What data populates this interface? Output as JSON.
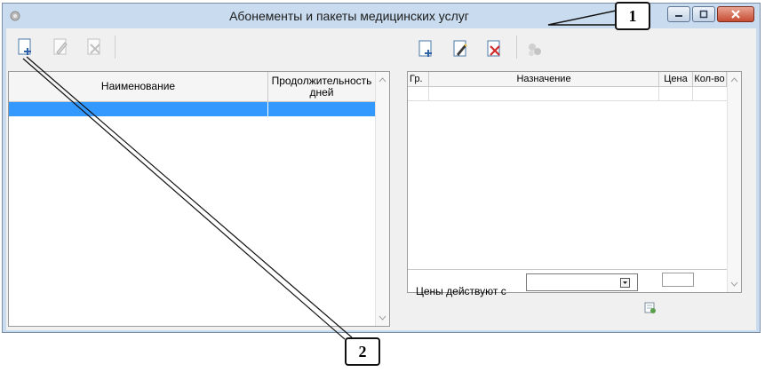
{
  "window": {
    "title": "Абонементы и пакеты медицинских услуг",
    "controls": [
      "minimize-icon",
      "maximize-icon",
      "close-icon"
    ]
  },
  "left_toolbar": {
    "icons": [
      "add-document-icon",
      "edit-pencil-icon",
      "delete-document-icon"
    ]
  },
  "left_table": {
    "columns": [
      "Наименование",
      "Продолжительность дней"
    ],
    "rows": []
  },
  "right_toolbar": {
    "icons": [
      "add-document-icon",
      "edit-pencil-icon",
      "delete-document-icon",
      "copy-services-icon"
    ]
  },
  "right_table": {
    "columns": [
      "Гр.",
      "Назначение",
      "Цена",
      "Кол-во"
    ],
    "rows": []
  },
  "footer": {
    "prices_label": "Цены действуют с",
    "date_value": ""
  },
  "callouts": {
    "one": "1",
    "two": "2"
  },
  "colors": {
    "selection": "#3399ff",
    "window_frame": "#c9dbee",
    "close_button": "#c74b32"
  }
}
